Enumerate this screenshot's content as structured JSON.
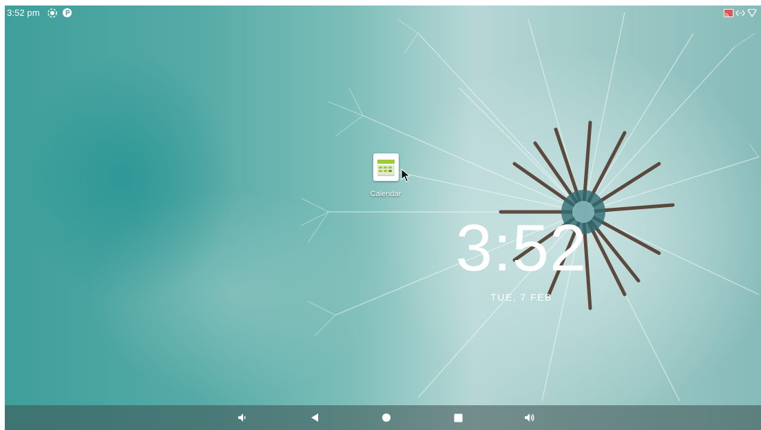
{
  "status_bar": {
    "time": "3:52 pm",
    "left_icons": [
      "screen-record-icon",
      "notification-app-icon"
    ],
    "right_icons": [
      "cast-icon",
      "ethernet-icon",
      "wifi-icon"
    ]
  },
  "desktop": {
    "apps": [
      {
        "label": "Calendar",
        "icon": "calendar-icon"
      }
    ]
  },
  "clock_widget": {
    "time": "3:52",
    "date": "TUE, 7 FEB"
  },
  "nav_bar": {
    "buttons": [
      "volume-down-icon",
      "back-icon",
      "home-icon",
      "recents-icon",
      "volume-up-icon"
    ]
  },
  "colors": {
    "accent_teal": "#3f9f9a",
    "nav_bar": "#3c5050",
    "text": "#ffffff"
  }
}
